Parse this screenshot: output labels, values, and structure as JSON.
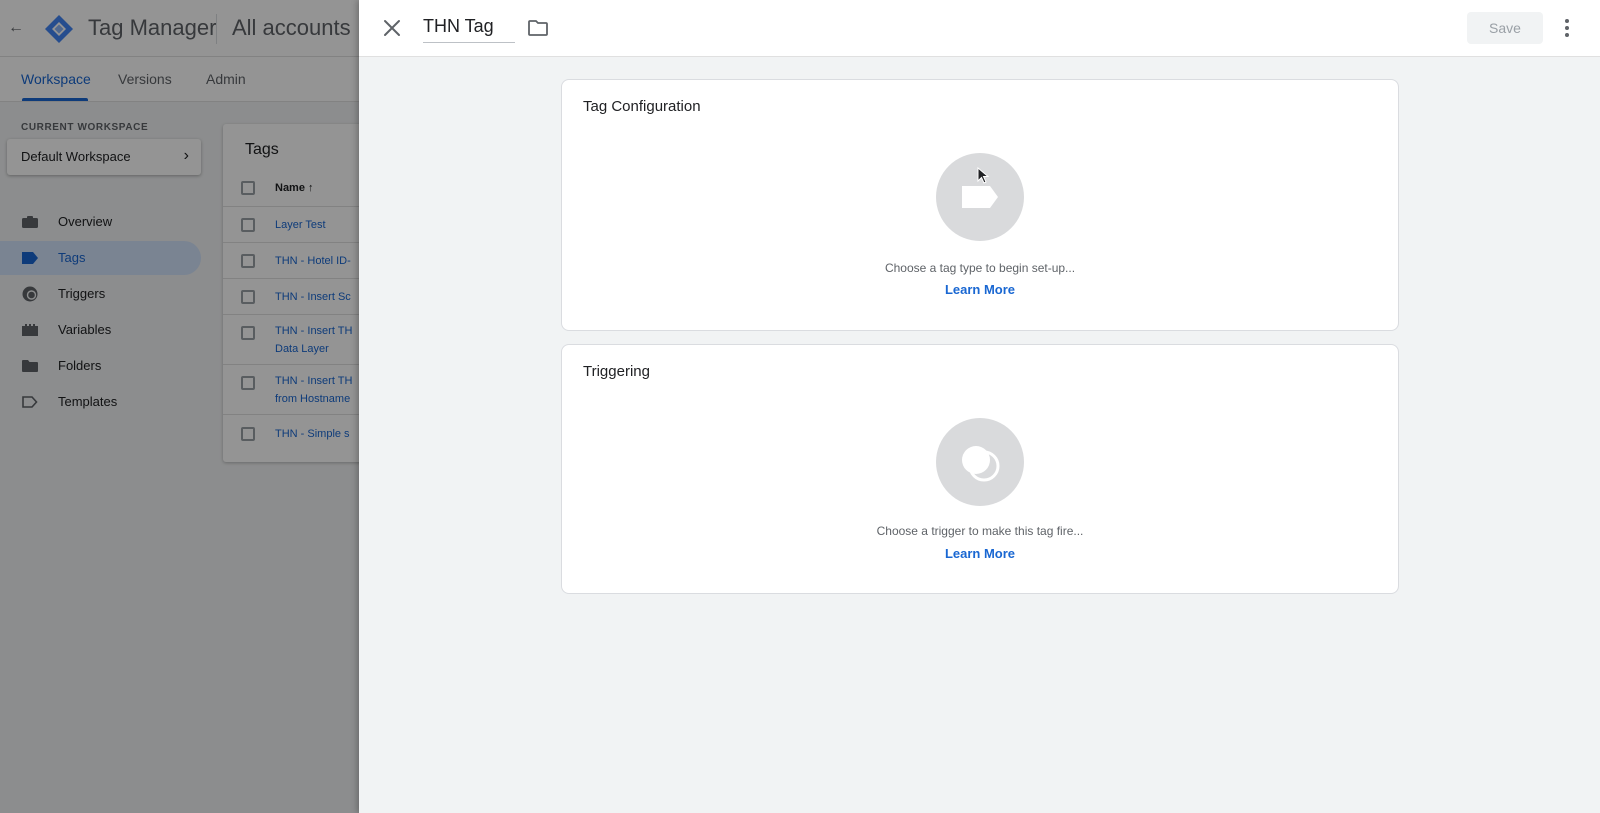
{
  "app": {
    "product_name": "Tag Manager",
    "account_crumb": "All accounts",
    "tabs": [
      {
        "label": "Workspace",
        "active": true
      },
      {
        "label": "Versions",
        "active": false
      },
      {
        "label": "Admin",
        "active": false
      }
    ],
    "workspace": {
      "section_label": "CURRENT WORKSPACE",
      "name": "Default Workspace"
    },
    "sidebar": {
      "items": [
        {
          "label": "Overview",
          "icon": "briefcase-icon",
          "active": false
        },
        {
          "label": "Tags",
          "icon": "tag-icon",
          "active": true
        },
        {
          "label": "Triggers",
          "icon": "trigger-icon",
          "active": false
        },
        {
          "label": "Variables",
          "icon": "variables-icon",
          "active": false
        },
        {
          "label": "Folders",
          "icon": "folder-icon",
          "active": false
        },
        {
          "label": "Templates",
          "icon": "template-icon",
          "active": false
        }
      ]
    },
    "tags_table": {
      "title": "Tags",
      "column_name": "Name ↑",
      "rows": [
        "Layer Test",
        "THN - Hotel ID-",
        "THN - Insert Sc",
        "THN - Insert TH Data Layer",
        "THN - Insert TH from Hostname",
        "THN - Simple s"
      ]
    }
  },
  "panel": {
    "tag_name": "THN Tag",
    "save_label": "Save",
    "tag_configuration": {
      "title": "Tag Configuration",
      "hint": "Choose a tag type to begin set-up...",
      "link": "Learn More"
    },
    "triggering": {
      "title": "Triggering",
      "hint": "Choose a trigger to make this tag fire...",
      "link": "Learn More"
    }
  },
  "colors": {
    "accent": "#1967d2",
    "active_nav_bg": "#d2e3fc",
    "placeholder_circle": "#d9dadc"
  }
}
